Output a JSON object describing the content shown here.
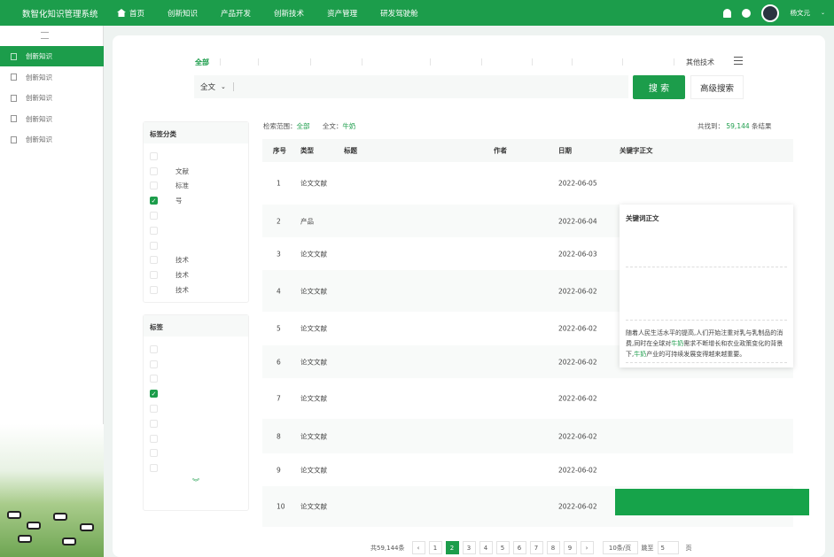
{
  "app": {
    "title": "数智化知识管理系统",
    "user": "杨文元"
  },
  "nav": [
    "首页",
    "创新知识",
    "产品开发",
    "创新技术",
    "资产管理",
    "研发驾驶舱"
  ],
  "sidebar": [
    "创新知识",
    "创新知识",
    "创新知识",
    "创新知识",
    "创新知识"
  ],
  "tabs": {
    "all": "全部",
    "other": "其他技术"
  },
  "search": {
    "scope_select": "全文",
    "button": "搜 索",
    "advanced": "高级搜索"
  },
  "scope": {
    "label": "检索范围：",
    "value": "全部",
    "field_label": "全文：",
    "field_value": "牛奶"
  },
  "found": {
    "label": "共找到：",
    "count": "59,144",
    "suffix": "条结果"
  },
  "filters": {
    "title": "标签分类",
    "items": [
      "",
      "文献",
      "标准",
      "号",
      "",
      "",
      "",
      "技术",
      "技术",
      "技术"
    ],
    "checked": [
      3
    ]
  },
  "tags": {
    "title": "标签",
    "count": 9,
    "checked": [
      3
    ]
  },
  "table": {
    "headers": [
      "序号",
      "类型",
      "标题",
      "作者",
      "日期",
      "关键字正文"
    ],
    "rows": [
      [
        "1",
        "论文文献",
        "2022-06-05"
      ],
      [
        "2",
        "产品",
        "2022-06-04"
      ],
      [
        "3",
        "论文文献",
        "2022-06-03"
      ],
      [
        "4",
        "论文文献",
        "2022-06-02"
      ],
      [
        "5",
        "论文文献",
        "2022-06-02"
      ],
      [
        "6",
        "论文文献",
        "2022-06-02"
      ],
      [
        "7",
        "论文文献",
        "2022-06-02"
      ],
      [
        "8",
        "论文文献",
        "2022-06-02"
      ],
      [
        "9",
        "论文文献",
        "2022-06-02"
      ],
      [
        "10",
        "论文文献",
        "2022-06-02"
      ]
    ]
  },
  "popover": {
    "title": "关键词正文",
    "text_a": "随着人民生活水平的提高,人们开始注重对乳与乳制品的消费,同时在全球对",
    "hl1": "牛奶",
    "text_b": "需求不断增长和农业政策变化的背景下,",
    "hl2": "牛奶",
    "text_c": "产业的可持续发展变得越来越重要。"
  },
  "pager": {
    "total": "共59,144条",
    "pages": [
      "1",
      "2",
      "3",
      "4",
      "5",
      "6",
      "7",
      "8",
      "9"
    ],
    "current": "2",
    "page_size": "10条/页",
    "goto_label": "跳至",
    "goto_value": "5",
    "goto_suffix": "页"
  },
  "colors": {
    "primary": "#1c9d4b"
  }
}
